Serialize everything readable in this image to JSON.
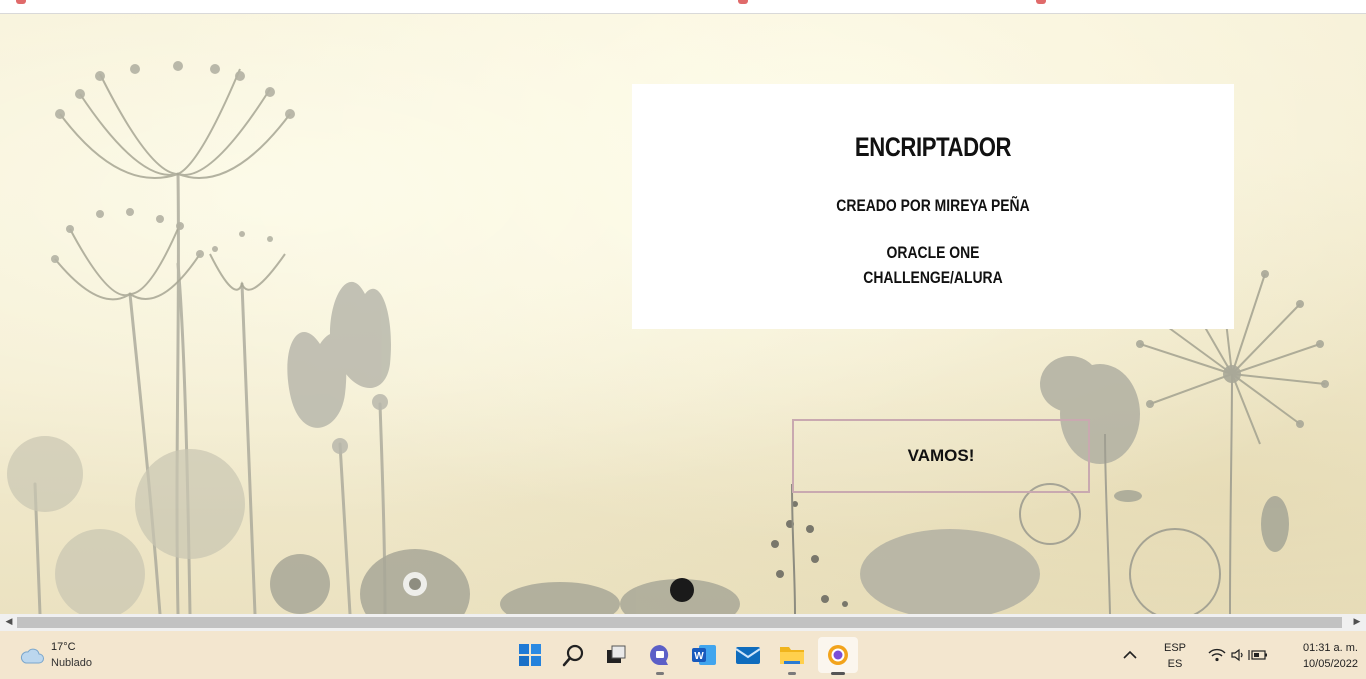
{
  "card": {
    "title": "ENCRIPTADOR",
    "subtitle": "CREADO POR MIREYA PEÑA",
    "org_line1": "ORACLE ONE",
    "org_line2": "CHALLENGE/ALURA"
  },
  "cta": {
    "label": "VAMOS!"
  },
  "taskbar": {
    "weather": {
      "temp": "17°C",
      "condition": "Nublado",
      "icon": "cloud-icon"
    },
    "apps": [
      {
        "name": "start",
        "icon": "windows-start-icon"
      },
      {
        "name": "search",
        "icon": "search-icon"
      },
      {
        "name": "task-view",
        "icon": "task-view-icon"
      },
      {
        "name": "chat",
        "icon": "chat-icon"
      },
      {
        "name": "word",
        "icon": "word-icon"
      },
      {
        "name": "mail",
        "icon": "mail-icon"
      },
      {
        "name": "file-explorer",
        "icon": "folder-icon"
      },
      {
        "name": "browser",
        "icon": "browser-icon"
      }
    ],
    "tray": {
      "lang_top": "ESP",
      "lang_bottom": "ES",
      "time": "01:31 a. m.",
      "date": "10/05/2022"
    }
  },
  "colors": {
    "page_bg": "#f1ead3",
    "card_bg": "#ffffff",
    "button_border": "#c9a9b0",
    "taskbar_bg": "#f3e6cf"
  }
}
